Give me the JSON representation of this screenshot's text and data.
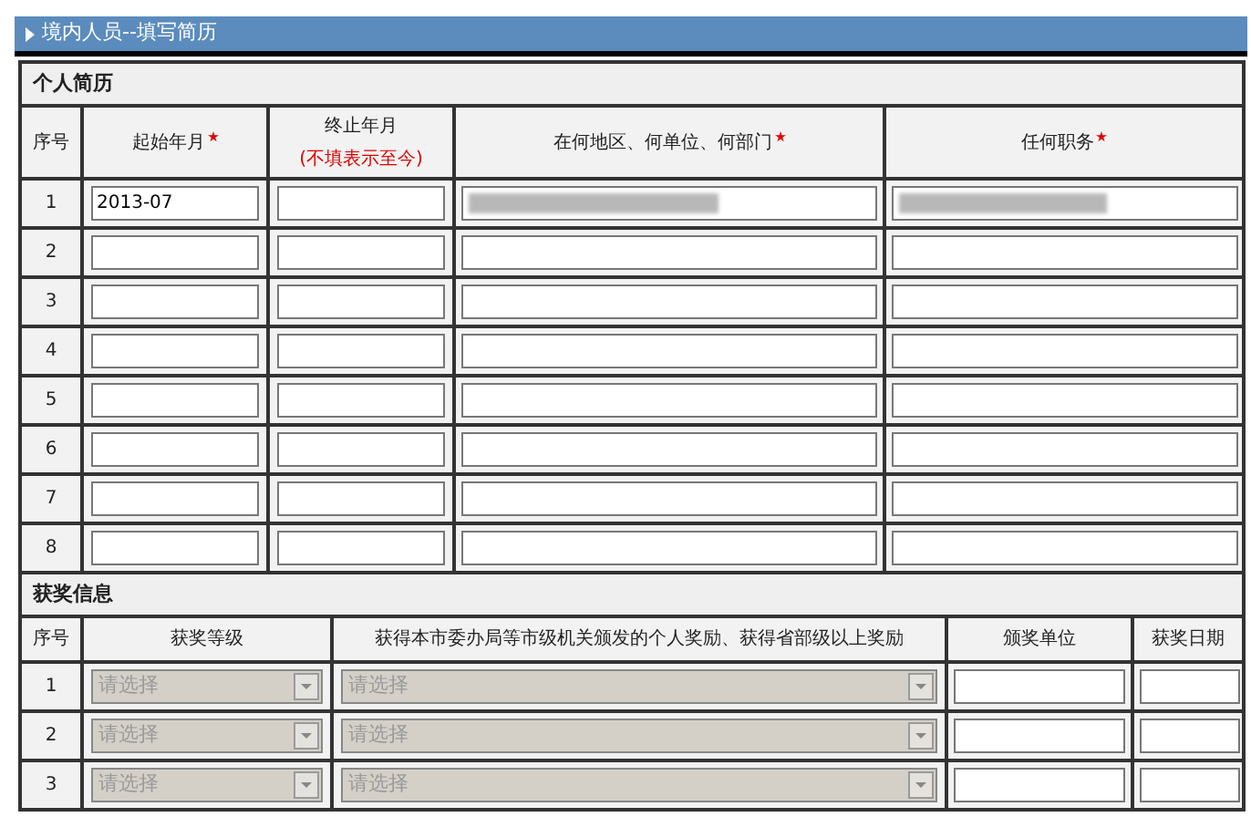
{
  "header": {
    "title": "境内人员--填写简历"
  },
  "resume": {
    "title": "个人简历",
    "columns": [
      {
        "label": "序号",
        "required": false
      },
      {
        "label": "起始年月",
        "required": true
      },
      {
        "label": "终止年月",
        "note": "(不填表示至今)",
        "required": false
      },
      {
        "label": "在何地区、何单位、何部门",
        "required": true
      },
      {
        "label": "任何职务",
        "required": true
      }
    ],
    "rows": [
      {
        "index": "1",
        "start": "2013-07",
        "end": "",
        "unit_redacted": true,
        "post_redacted": true
      },
      {
        "index": "2",
        "start": "",
        "end": "",
        "unit_redacted": false,
        "post_redacted": false
      },
      {
        "index": "3",
        "start": "",
        "end": "",
        "unit_redacted": false,
        "post_redacted": false
      },
      {
        "index": "4",
        "start": "",
        "end": "",
        "unit_redacted": false,
        "post_redacted": false
      },
      {
        "index": "5",
        "start": "",
        "end": "",
        "unit_redacted": false,
        "post_redacted": false
      },
      {
        "index": "6",
        "start": "",
        "end": "",
        "unit_redacted": false,
        "post_redacted": false
      },
      {
        "index": "7",
        "start": "",
        "end": "",
        "unit_redacted": false,
        "post_redacted": false
      },
      {
        "index": "8",
        "start": "",
        "end": "",
        "unit_redacted": false,
        "post_redacted": false
      }
    ]
  },
  "awards": {
    "title": "获奖信息",
    "columns": [
      "序号",
      "获奖等级",
      "获得本市委办局等市级机关颁发的个人奖励、获得省部级以上奖励",
      "颁奖单位",
      "获奖日期"
    ],
    "rows": [
      {
        "index": "1",
        "level_placeholder": "请选择",
        "award_placeholder": "请选择",
        "disabled": true
      },
      {
        "index": "2",
        "level_placeholder": "请选择",
        "award_placeholder": "请选择",
        "disabled": true
      },
      {
        "index": "3",
        "level_placeholder": "请选择",
        "award_placeholder": "请选择",
        "disabled": true
      }
    ]
  }
}
